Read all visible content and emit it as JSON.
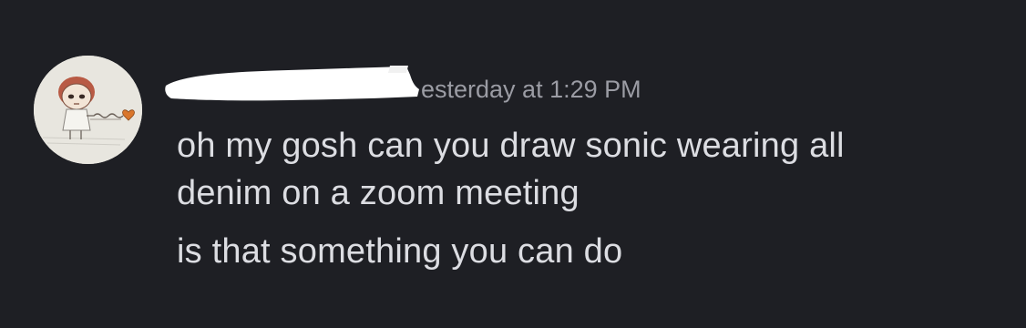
{
  "message": {
    "timestamp": "esterday at 1:29 PM",
    "lines": [
      "oh my gosh can you draw sonic wearing all",
      "denim on a zoom meeting"
    ],
    "second_message": "is that something you can do"
  },
  "avatar": {
    "icon": "girl-with-heart-drawing"
  },
  "colors": {
    "background": "#1e1f24",
    "message_text": "#dcdde2",
    "timestamp_text": "#9b9ca4",
    "redaction": "#ffffff"
  }
}
